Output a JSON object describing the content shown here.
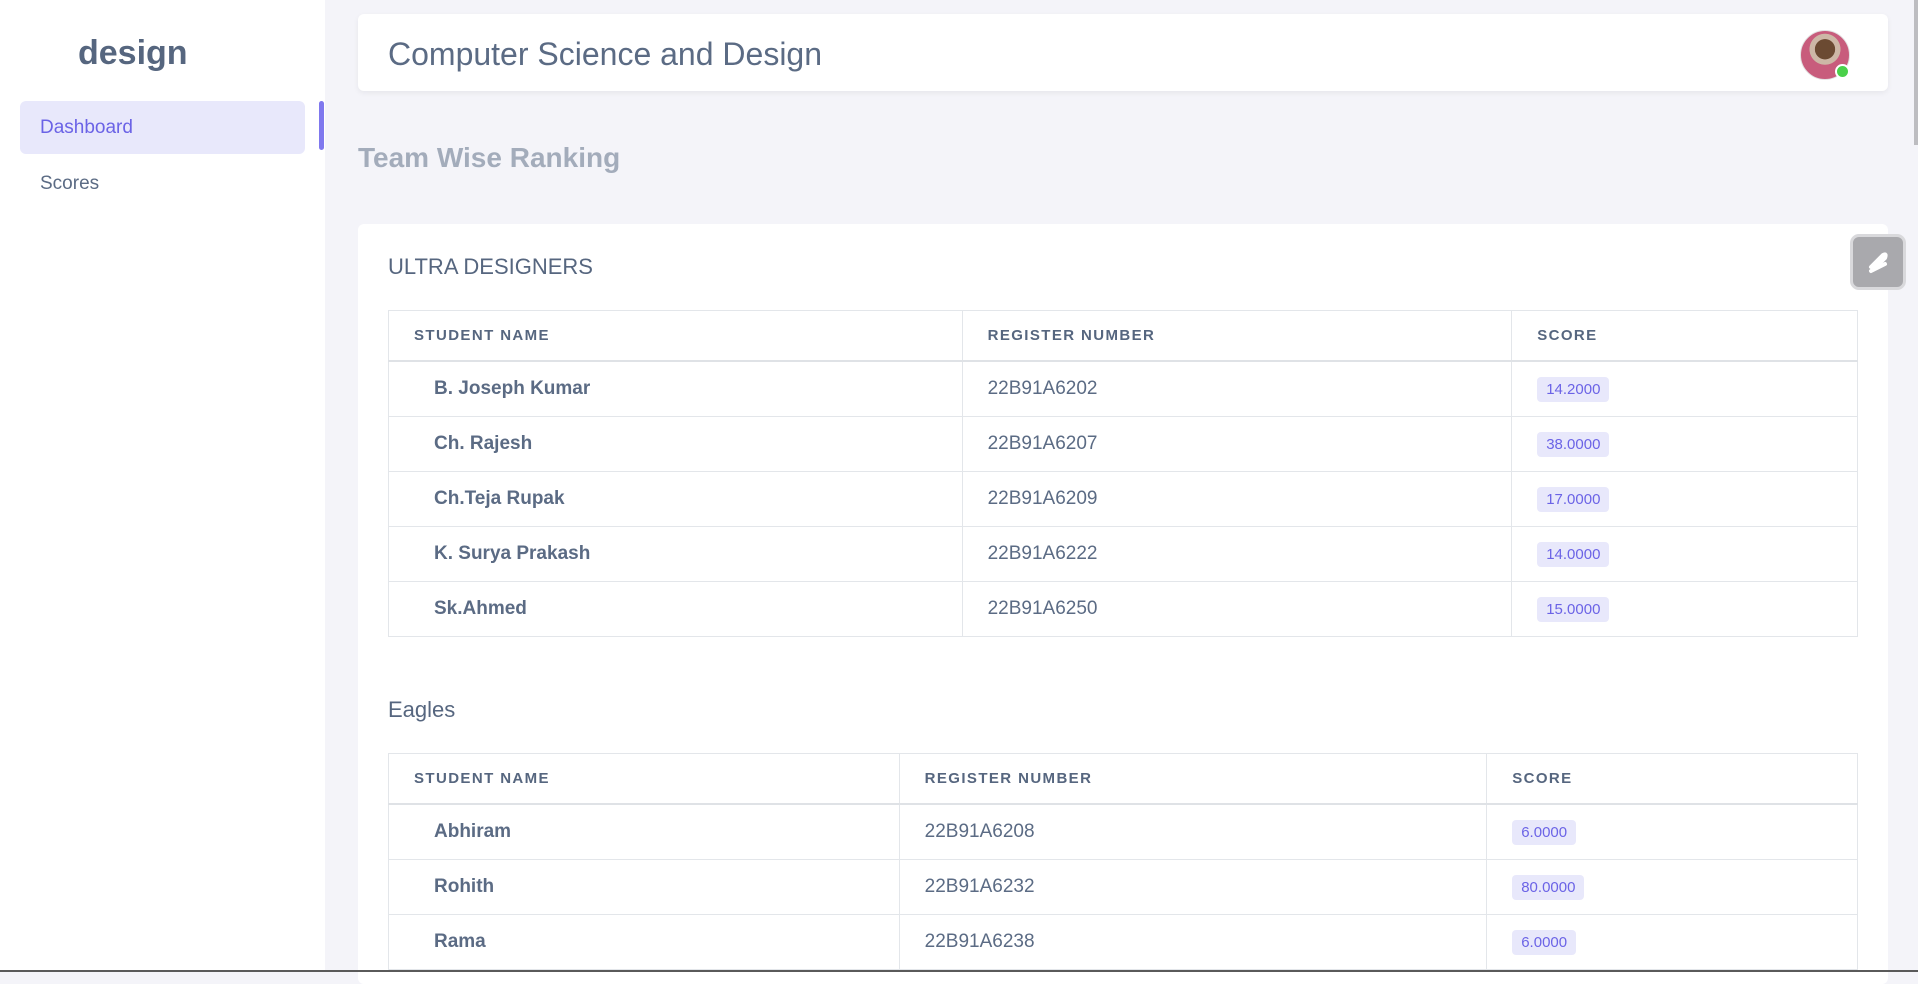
{
  "brand": "design",
  "nav": {
    "items": [
      {
        "label": "Dashboard",
        "active": true
      },
      {
        "label": "Scores",
        "active": false
      }
    ]
  },
  "header": {
    "title": "Computer Science and Design"
  },
  "section_title": "Team Wise Ranking",
  "columns": [
    "STUDENT NAME",
    "REGISTER NUMBER",
    "SCORE"
  ],
  "teams": [
    {
      "name": "ULTRA DESIGNERS",
      "rows": [
        {
          "name": "B. Joseph Kumar",
          "reg": "22B91A6202",
          "score": "14.2000"
        },
        {
          "name": "Ch. Rajesh",
          "reg": "22B91A6207",
          "score": "38.0000"
        },
        {
          "name": "Ch.Teja Rupak",
          "reg": "22B91A6209",
          "score": "17.0000"
        },
        {
          "name": "K. Surya Prakash",
          "reg": "22B91A6222",
          "score": "14.0000"
        },
        {
          "name": "Sk.Ahmed",
          "reg": "22B91A6250",
          "score": "15.0000"
        }
      ]
    },
    {
      "name": "Eagles",
      "rows": [
        {
          "name": "Abhiram",
          "reg": "22B91A6208",
          "score": "6.0000"
        },
        {
          "name": "Rohith",
          "reg": "22B91A6232",
          "score": "80.0000"
        },
        {
          "name": "Rama",
          "reg": "22B91A6238",
          "score": "6.0000"
        }
      ]
    }
  ],
  "colors": {
    "accent": "#6b63e6",
    "badge_bg": "#e8e8fb",
    "page_bg": "#f4f4f9"
  }
}
